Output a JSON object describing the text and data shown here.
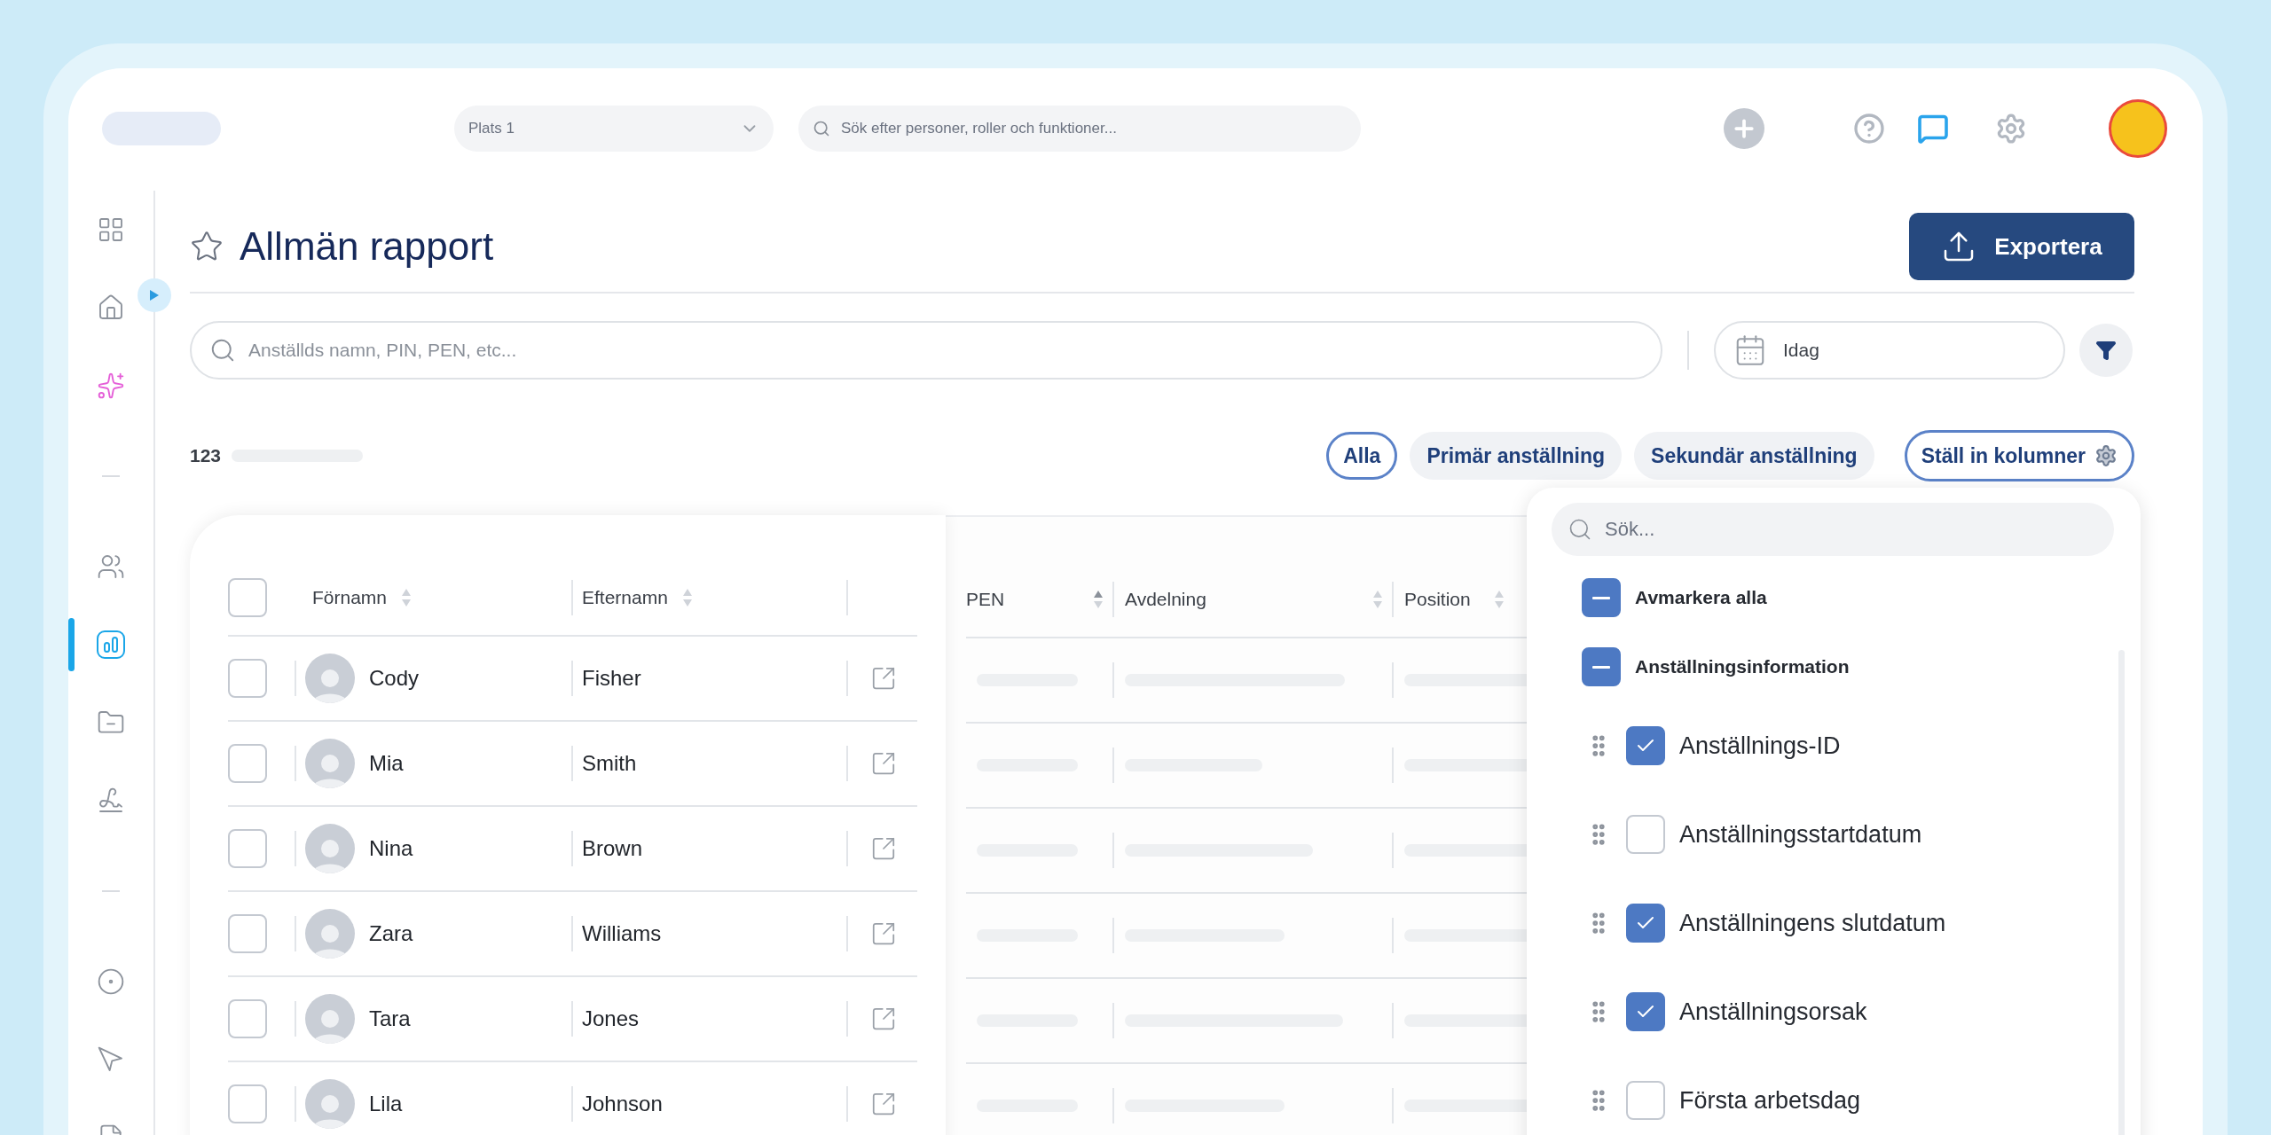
{
  "header": {
    "location_select": {
      "value": "Plats 1"
    },
    "search": {
      "placeholder": "Sök efter personer, roller och funktioner..."
    }
  },
  "sidebar": {
    "items": [
      {
        "kind": "apps",
        "selected": false
      },
      {
        "kind": "home",
        "selected": false
      },
      {
        "kind": "sparkles",
        "selected": false
      },
      {
        "kind": "divider"
      },
      {
        "kind": "people",
        "selected": false
      },
      {
        "kind": "reports",
        "selected": true
      },
      {
        "kind": "folder",
        "selected": false
      },
      {
        "kind": "signature",
        "selected": false
      },
      {
        "kind": "divider"
      },
      {
        "kind": "target",
        "selected": false
      },
      {
        "kind": "pointer",
        "selected": false
      },
      {
        "kind": "document",
        "selected": false
      }
    ]
  },
  "page": {
    "title": "Allmän rapport",
    "favorite": false,
    "export_button": "Exportera"
  },
  "filters": {
    "search_placeholder": "Anställds namn, PIN, PEN, etc...",
    "date": "Idag"
  },
  "count": "123",
  "tabs": [
    {
      "label": "Alla",
      "selected": true
    },
    {
      "label": "Primär anställning",
      "selected": false
    },
    {
      "label": "Sekundär anställning",
      "selected": false
    }
  ],
  "columns_button": "Ställ in kolumner",
  "table": {
    "all_checked": false,
    "columns": [
      {
        "label": "Förnamn",
        "sorted_ascending": false
      },
      {
        "label": "Efternamn",
        "sorted_ascending": false
      },
      {
        "label": "PEN",
        "sorted_ascending": true
      },
      {
        "label": "Avdelning",
        "sorted_ascending": false
      },
      {
        "label": "Position",
        "sorted_ascending": false
      }
    ],
    "rows": [
      {
        "first": "Cody",
        "last": "Fisher",
        "checked": false
      },
      {
        "first": "Mia",
        "last": "Smith",
        "checked": false
      },
      {
        "first": "Nina",
        "last": "Brown",
        "checked": false
      },
      {
        "first": "Zara",
        "last": "Williams",
        "checked": false
      },
      {
        "first": "Tara",
        "last": "Jones",
        "checked": false
      },
      {
        "first": "Lila",
        "last": "Johnson",
        "checked": false
      }
    ]
  },
  "column_menu": {
    "search_placeholder": "Sök...",
    "items": [
      {
        "kind": "action",
        "label": "Avmarkera alla",
        "checked": false,
        "indeterminate": true
      },
      {
        "kind": "group",
        "label": "Anställningsinformation",
        "checked": false,
        "indeterminate": true
      },
      {
        "kind": "column",
        "label": "Anställnings-ID",
        "checked": true,
        "indeterminate": false
      },
      {
        "kind": "column",
        "label": "Anställningsstartdatum",
        "checked": false,
        "indeterminate": false
      },
      {
        "kind": "column",
        "label": "Anställningens slutdatum",
        "checked": true,
        "indeterminate": false
      },
      {
        "kind": "column",
        "label": "Anställningsorsak",
        "checked": true,
        "indeterminate": false
      },
      {
        "kind": "column",
        "label": "Första arbetsdag",
        "checked": false,
        "indeterminate": false
      }
    ]
  }
}
